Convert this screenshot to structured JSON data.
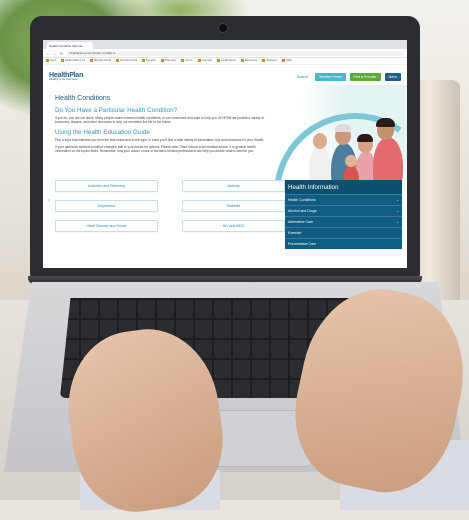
{
  "browser": {
    "tab_title": "Health Condition Informa...",
    "address": "healthplansj.com/health-conditions",
    "bookmarks": [
      "Apps",
      "Health Plan of SJ",
      "Member Portal",
      "Provider Portal",
      "Benefits",
      "Pharmacy",
      "Forms",
      "Calendar",
      "Health News",
      "Resources",
      "Wellness",
      "Other"
    ]
  },
  "site": {
    "logo_main": "HealthPlan",
    "logo_sub": "Healthy is for everyone",
    "search_label": "Search",
    "member_button": "Member Portal",
    "provider_button": "Find a Provider",
    "menu_button": "Menu"
  },
  "content": {
    "page_title": "Health Conditions",
    "question_heading": "Do You Have a Particular Health Condition?",
    "intro_text": "If you do, you are not alone. Many people share common health conditions, or are concerned and want to help you. At HPSM we provide a variety of brochures, classes, and other resources to help our members live life to the fullest.",
    "guide_heading": "Using the Health Education Guide",
    "guide_text_1": "Pick a topic that interests you from the lists below and to the right. In each you'll find a wide variety of information, tips and resources for your Health.",
    "guide_text_2": "If your particular medical condition changes, talk to your doctor for options. Please note: Often follows a set medical advice. It is general health information on the topics listed. Remember, only your doctor, nurse or licensed medical professional can help you decide what is best for you."
  },
  "topics": [
    "Addiction and Recovery",
    "Asthma",
    "Depression",
    "Diabetes",
    "Heart Disease and Stroke",
    "HIV and AIDS"
  ],
  "health_panel": {
    "title": "Health Information",
    "items": [
      {
        "label": "Health Conditions",
        "has_chevron": true
      },
      {
        "label": "Alcohol and Drugs",
        "has_chevron": true
      },
      {
        "label": "Alternative Care",
        "has_chevron": true
      },
      {
        "label": "Exercise",
        "has_chevron": false
      },
      {
        "label": "Preventative Care",
        "has_chevron": false
      }
    ]
  },
  "colors": {
    "brand_dark": "#1f5e8a",
    "brand_teal": "#4db3c8",
    "brand_green": "#5aa83c",
    "panel_blue": "#0f5d82",
    "link_blue": "#2b9ac2"
  },
  "icons": [
    "back-arrow-icon",
    "forward-arrow-icon",
    "reload-icon",
    "chevron-down-icon",
    "slider-left-arrow-icon"
  ]
}
